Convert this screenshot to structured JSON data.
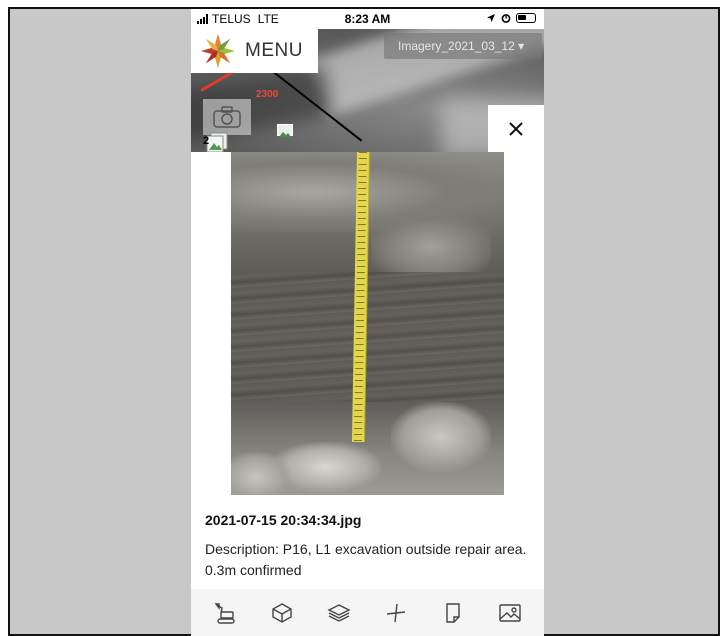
{
  "statusbar": {
    "carrier": "TELUS",
    "network": "LTE",
    "time": "8:23 AM"
  },
  "header": {
    "menu_label": "MENU",
    "imagery_selector": "Imagery_2021_03_12 ▾"
  },
  "map": {
    "station_label": "2300",
    "photo_stack_count": "2"
  },
  "dialog": {
    "close_icon": "close-icon",
    "photo_filename": "2021-07-15 20:34:34.jpg",
    "photo_description": "Description: P16, L1 excavation outside repair area. 0.3m confirmed"
  },
  "toolbar": {
    "items": [
      {
        "icon": "excavator-icon"
      },
      {
        "icon": "cube-icon"
      },
      {
        "icon": "layers-icon"
      },
      {
        "icon": "measure-icon"
      },
      {
        "icon": "note-icon"
      },
      {
        "icon": "image-icon"
      }
    ]
  },
  "colors": {
    "accent_red": "#e23a2c",
    "tape_yellow": "#e4d64a",
    "toolbar_bg": "#f5f5f5"
  }
}
